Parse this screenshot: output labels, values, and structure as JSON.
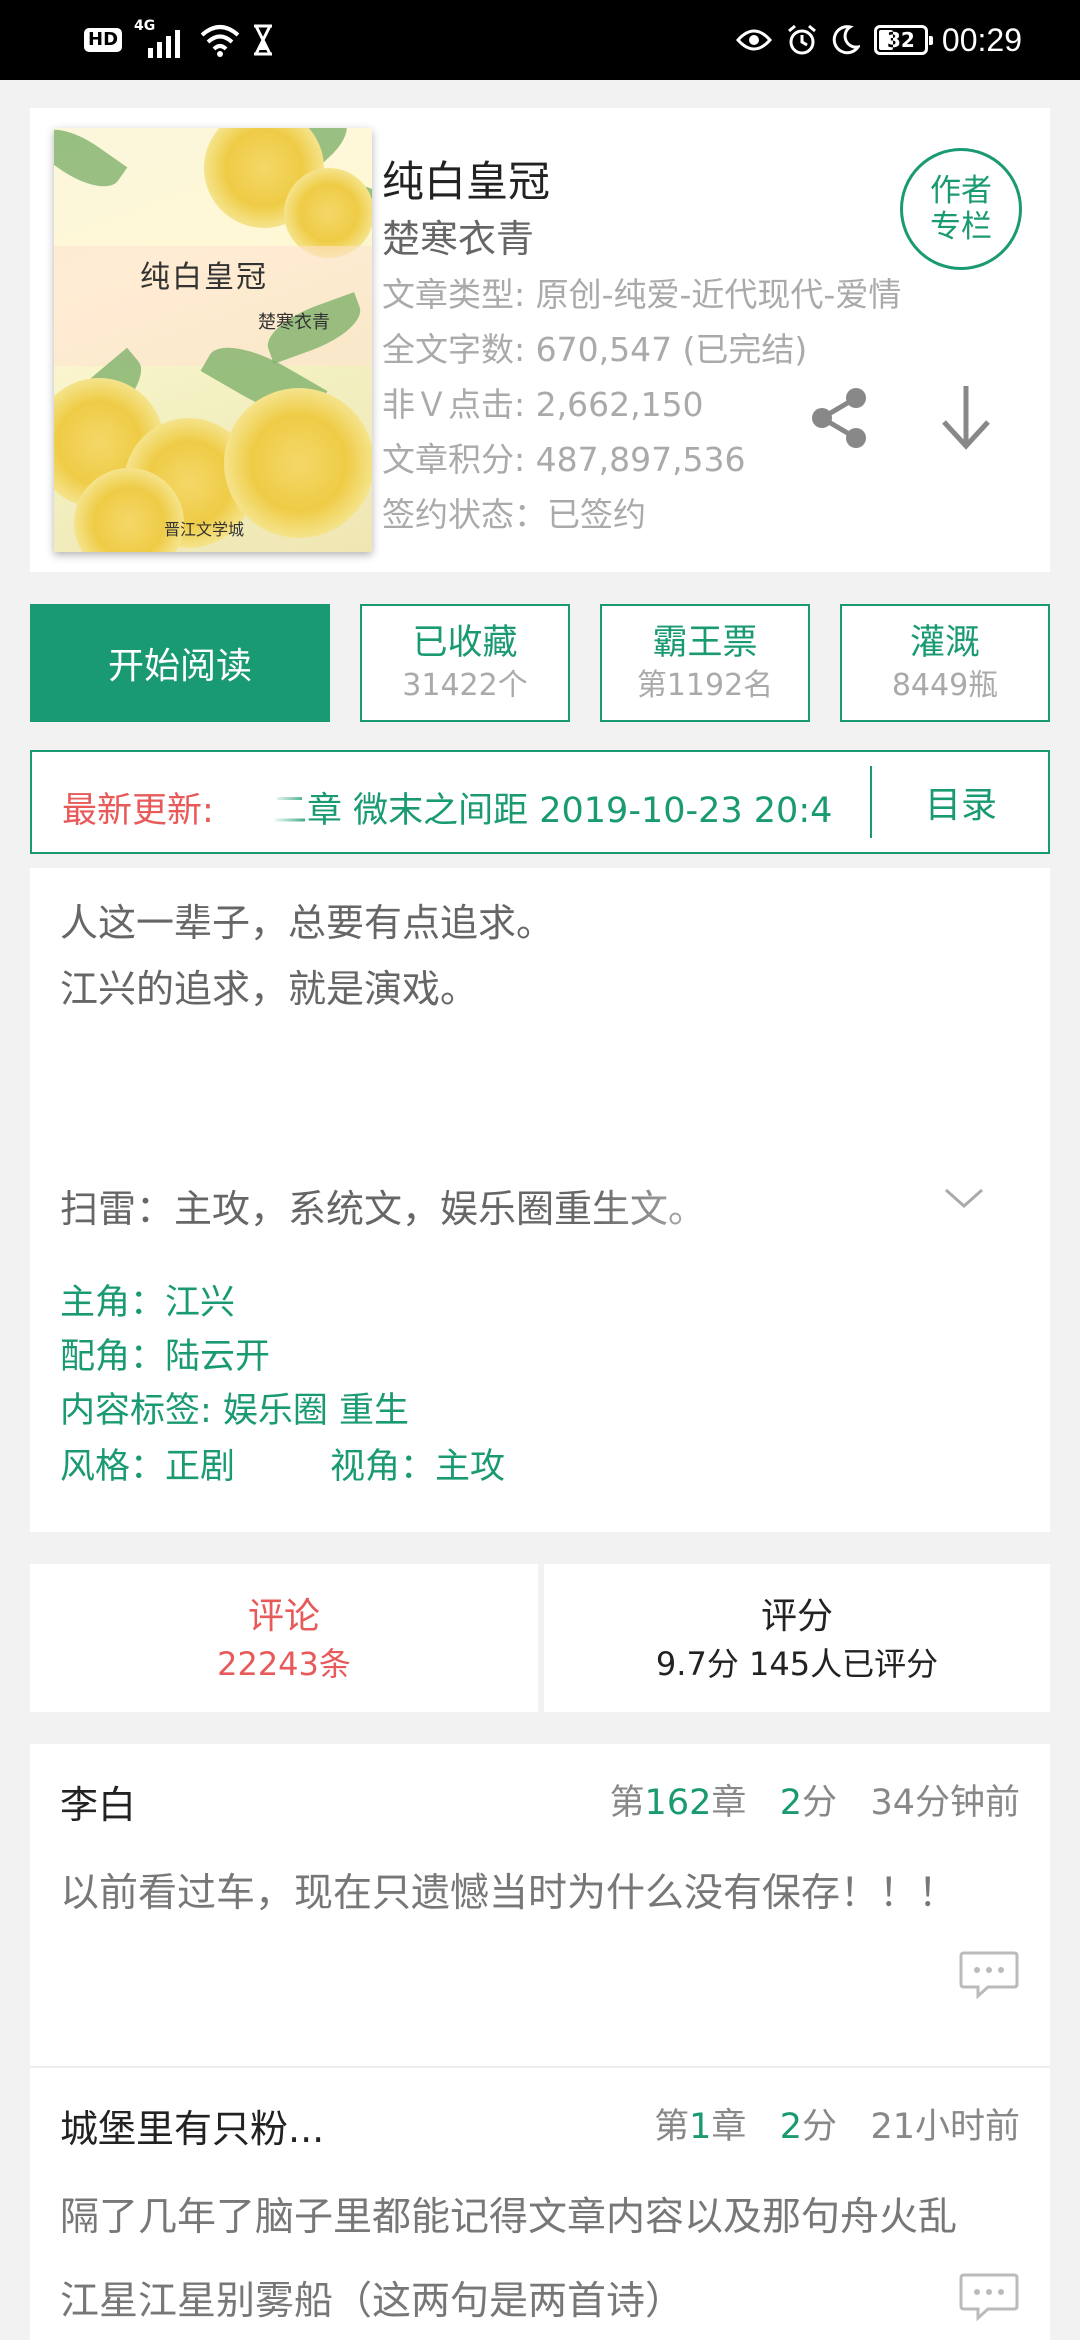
{
  "status_bar": {
    "hd": "HD",
    "network": "4G",
    "battery": "32",
    "time": "00:29"
  },
  "book": {
    "cover": {
      "title": "纯白皇冠",
      "author": "楚寒衣青",
      "publisher": "晋江文学城"
    },
    "title": "纯白皇冠",
    "author": "楚寒衣青",
    "info": [
      "文章类型: 原创-纯爱-近代现代-爱情",
      "全文字数: 670,547 (已完结)",
      "非Ｖ点击: 2,662,150",
      "文章积分: 487,897,536",
      "签约状态：已签约"
    ],
    "author_column_btn": "作者专栏",
    "author_column_btn_line1": "作者",
    "author_column_btn_line2": "专栏"
  },
  "actions": {
    "read": "开始阅读",
    "favorite": {
      "label": "已收藏",
      "value": "31422个"
    },
    "ticket": {
      "label": "霸王票",
      "value": "第1192名"
    },
    "irrigate": {
      "label": "灌溉",
      "value": "8449瓶"
    }
  },
  "latest_update": {
    "label": "最新更新:",
    "text": "二章 微末之间距  2019-10-23 20:4",
    "toc": "目录"
  },
  "summary": {
    "lines": [
      "人这一辈子，总要有点追求。",
      "江兴的追求，就是演戏。",
      "扫雷：主攻，系统文，娱乐圈重生文。"
    ],
    "protagonist": "主角：江兴",
    "supporting": "配角：陆云开",
    "tags": "内容标签: 娱乐圈  重生",
    "style": "风格：正剧",
    "perspective": "视角：主攻"
  },
  "tabs": {
    "comments": {
      "label": "评论",
      "count": "22243条"
    },
    "rating": {
      "label": "评分",
      "value": "9.7分 145人已评分"
    }
  },
  "comments": [
    {
      "user": "李白",
      "chapter_prefix": "第",
      "chapter_num": "162",
      "chapter_suffix": "章",
      "score_num": "2",
      "score_suffix": "分",
      "time": "34分钟前",
      "body": "以前看过车，现在只遗憾当时为什么没有保存！！！"
    },
    {
      "user": "城堡里有只粉...",
      "chapter_prefix": "第",
      "chapter_num": "1",
      "chapter_suffix": "章",
      "score_num": "2",
      "score_suffix": "分",
      "time": "21小时前",
      "body": "隔了几年了脑子里都能记得文章内容以及那句舟火乱江星江星别雾船（这两句是两首诗）"
    }
  ],
  "colors": {
    "accent": "#1a9a72",
    "highlight": "#e85a5a"
  }
}
